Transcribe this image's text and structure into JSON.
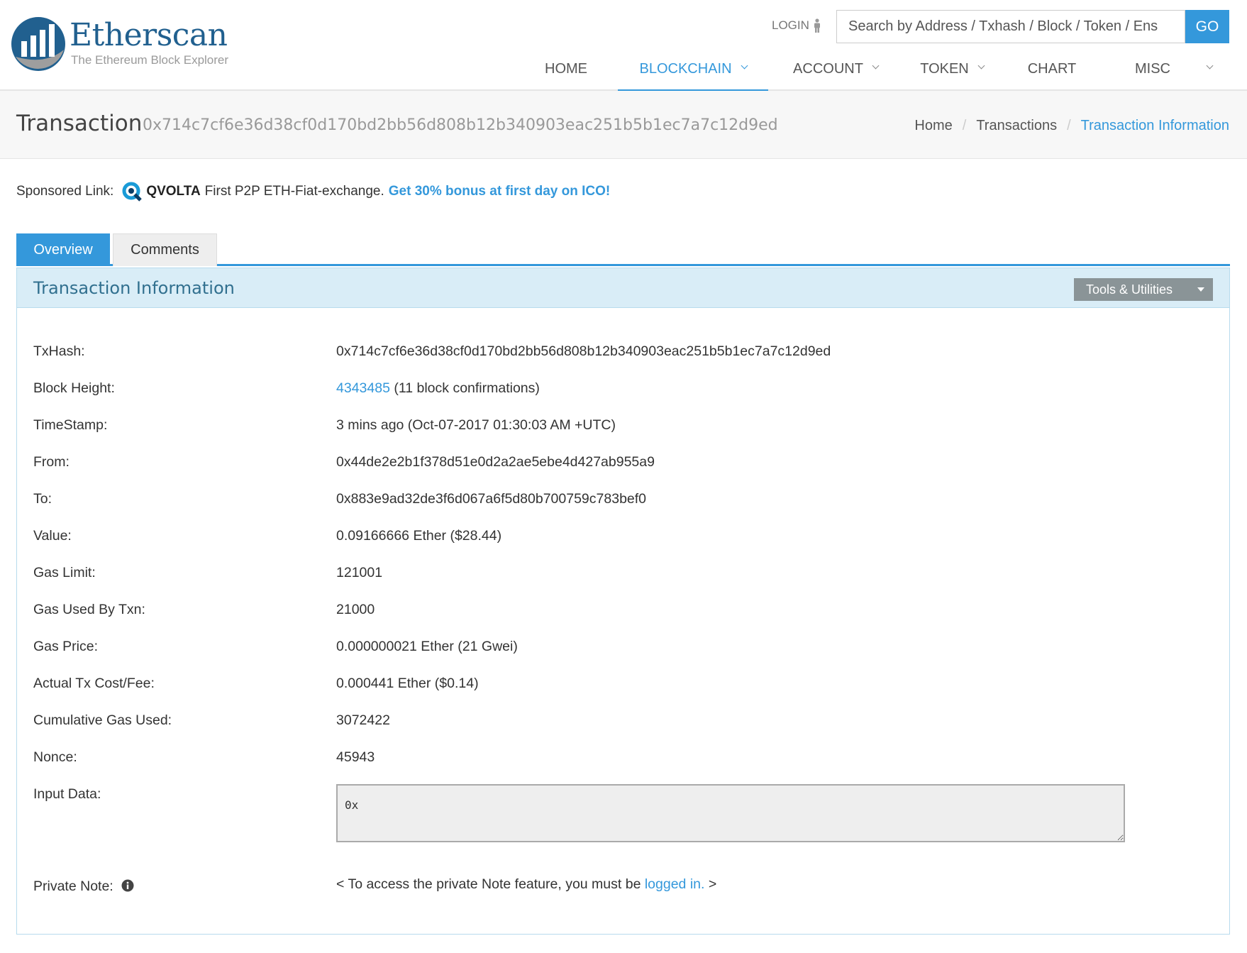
{
  "header": {
    "logo_name": "Etherscan",
    "logo_tagline": "The Ethereum Block Explorer",
    "login_label": "LOGIN",
    "search_placeholder": "Search by Address / Txhash / Block / Token / Ens",
    "go_label": "GO",
    "nav": [
      {
        "label": "HOME",
        "has_dropdown": false,
        "active": false
      },
      {
        "label": "BLOCKCHAIN",
        "has_dropdown": true,
        "active": true
      },
      {
        "label": "ACCOUNT",
        "has_dropdown": true,
        "active": false
      },
      {
        "label": "TOKEN",
        "has_dropdown": true,
        "active": false
      },
      {
        "label": "CHART",
        "has_dropdown": false,
        "active": false
      },
      {
        "label": "MISC",
        "has_dropdown": false,
        "active": false
      }
    ],
    "accent_color": "#3498db"
  },
  "titlebar": {
    "title": "Transaction",
    "hash": "0x714c7cf6e36d38cf0d170bd2bb56d808b12b340903eac251b5b1ec7a7c12d9ed",
    "breadcrumb": [
      "Home",
      "Transactions",
      "Transaction Information"
    ]
  },
  "sponsor": {
    "prefix": "Sponsored Link:",
    "brand": "QVOLTA",
    "text": "First P2P ETH-Fiat-exchange.",
    "promo": "Get 30% bonus at first day on ICO!"
  },
  "tabs": [
    "Overview",
    "Comments"
  ],
  "panel": {
    "title": "Transaction Information",
    "tools_label": "Tools & Utilities",
    "rows": {
      "txhash": {
        "label": "TxHash:",
        "value": "0x714c7cf6e36d38cf0d170bd2bb56d808b12b340903eac251b5b1ec7a7c12d9ed"
      },
      "block": {
        "label": "Block Height:",
        "value": "4343485",
        "suffix": "(11 block confirmations)"
      },
      "timestamp": {
        "label": "TimeStamp:",
        "value": "3 mins ago (Oct-07-2017 01:30:03 AM +UTC)"
      },
      "from": {
        "label": "From:",
        "value": "0x44de2e2b1f378d51e0d2a2ae5ebe4d427ab955a9"
      },
      "to": {
        "label": "To:",
        "value": "0x883e9ad32de3f6d067a6f5d80b700759c783bef0"
      },
      "value": {
        "label": "Value:",
        "value": "0.09166666 Ether ($28.44)"
      },
      "gas_limit": {
        "label": "Gas Limit:",
        "value": "121001"
      },
      "gas_used": {
        "label": "Gas Used By Txn:",
        "value": "21000"
      },
      "gas_price": {
        "label": "Gas Price:",
        "value": "0.000000021 Ether (21 Gwei)"
      },
      "fee": {
        "label": "Actual Tx Cost/Fee:",
        "value": "0.000441 Ether ($0.14)"
      },
      "cumulative": {
        "label": "Cumulative Gas Used:",
        "value": "3072422"
      },
      "nonce": {
        "label": "Nonce:",
        "value": "45943"
      },
      "input": {
        "label": "Input Data:",
        "value": "0x"
      },
      "note": {
        "label": "Private Note:",
        "prefix": "< To access the private Note feature, you must be",
        "link": "logged in.",
        "suffix": ">"
      }
    }
  }
}
